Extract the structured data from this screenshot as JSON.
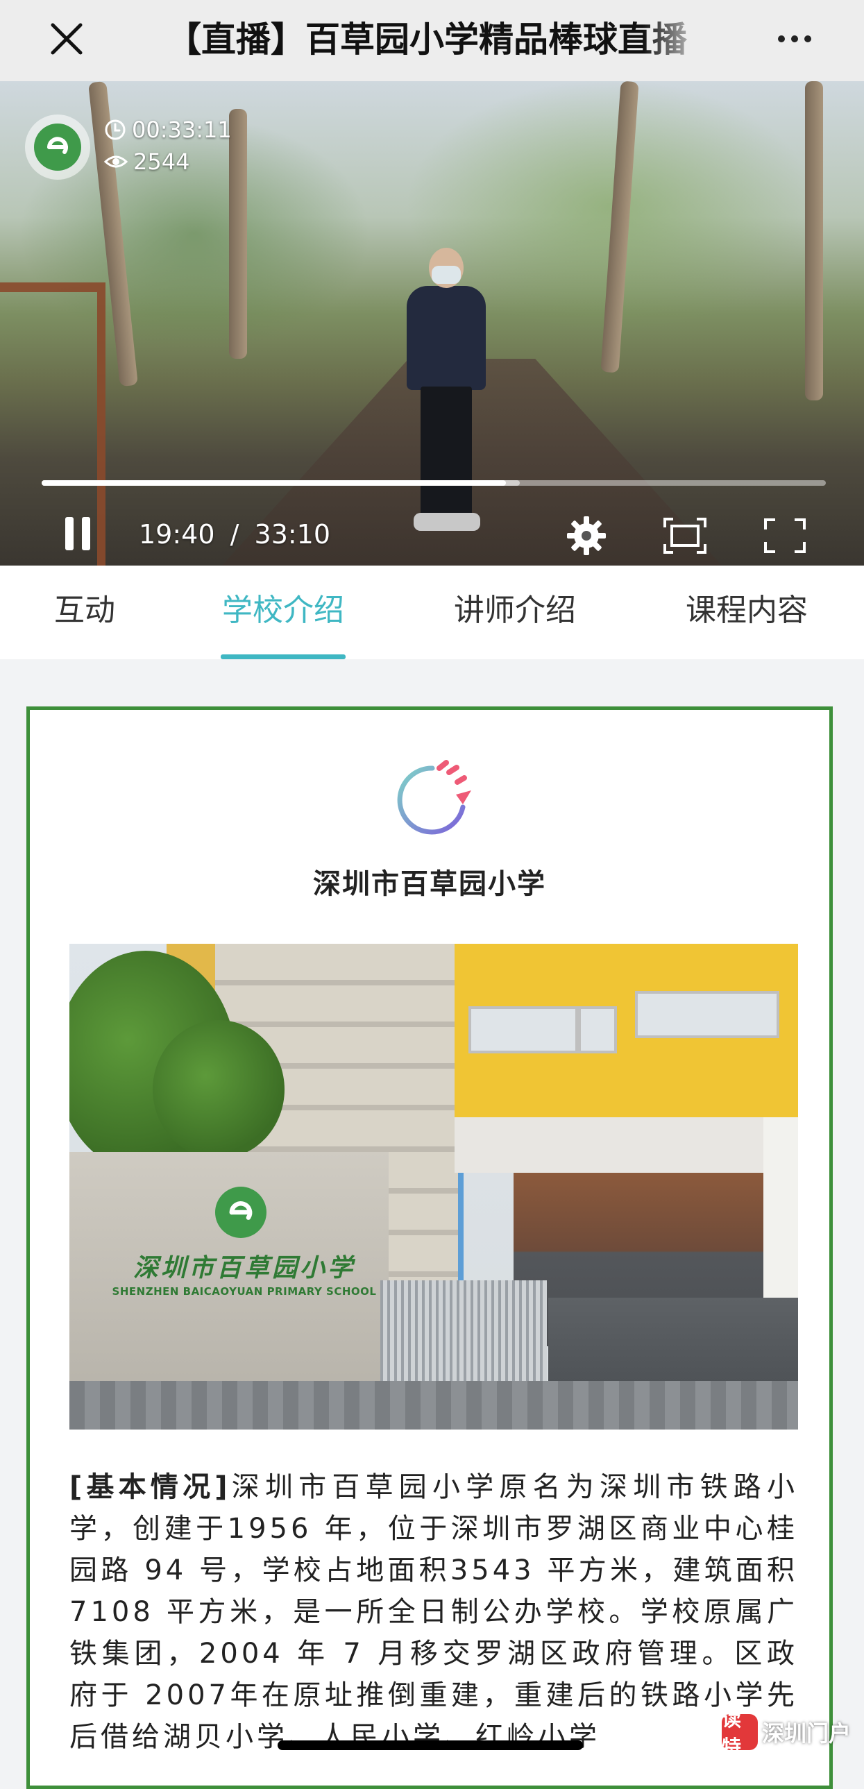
{
  "header": {
    "title": "【直播】百草园小学精品棒球直播",
    "close_icon": "close-icon",
    "more_icon": "more-dots-icon"
  },
  "video": {
    "live_duration": "00:33:11",
    "viewer_count": "2544",
    "current_time": "19:40",
    "separator": "/",
    "total_time": "33:10",
    "progress": 0.592,
    "buffered": 0.61,
    "controls": [
      "pause-icon",
      "settings-gear-icon",
      "screen-fit-icon",
      "fullscreen-icon"
    ]
  },
  "tabs": [
    {
      "label": "互动",
      "active": false
    },
    {
      "label": "学校介绍",
      "active": true
    },
    {
      "label": "讲师介绍",
      "active": false
    },
    {
      "label": "课程内容",
      "active": false
    }
  ],
  "school": {
    "name": "深圳市百草园小学",
    "sign_cn": "深圳市百草园小学",
    "sign_en": "SHENZHEN BAICAOYUAN PRIMARY SCHOOL",
    "intro_label": "[基本情况]",
    "intro_text": "深圳市百草园小学原名为深圳市铁路小学，创建于1956 年，位于深圳市罗湖区商业中心桂园路 94 号，学校占地面积3543 平方米，建筑面积 7108 平方米，是一所全日制公办学校。学校原属广铁集团，2004 年 7 月移交罗湖区政府管理。区政府于 2007年在原址推倒重建，重建后的铁路小学先后借给湖贝小学、人民小学、红岭小学"
  },
  "watermark": {
    "badge": "读特",
    "text": "深圳门户"
  },
  "colors": {
    "accent": "#3fb7c3",
    "card_border": "#3e8f3a",
    "header_bg": "#ededed"
  }
}
